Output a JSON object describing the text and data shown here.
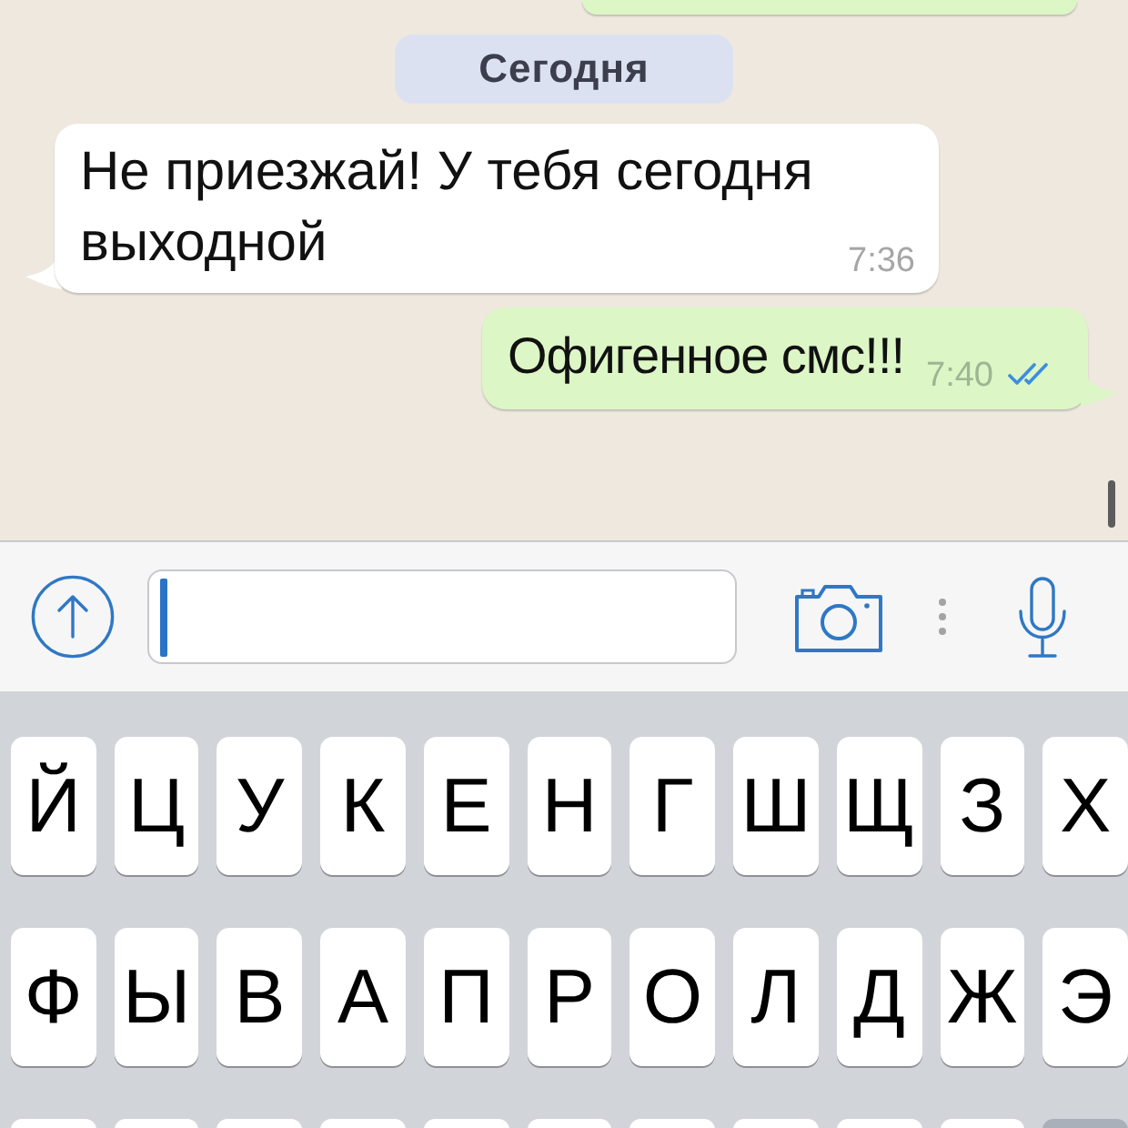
{
  "chat": {
    "items": [
      {
        "kind": "outgoing",
        "cut_off": true
      },
      {
        "kind": "date",
        "text": "Сегодня"
      },
      {
        "kind": "incoming",
        "cut_off": false,
        "text": "Не приезжай! У тебя сегодня выходной",
        "time": "7:36"
      },
      {
        "kind": "outgoing",
        "cut_off": false,
        "text": "Офигенное смс!!!",
        "time": "7:40",
        "read": true
      }
    ]
  },
  "composer": {
    "focused": true
  },
  "keyboard": {
    "rows": [
      {
        "cut_off": false,
        "keys": [
          {
            "kind": "letter",
            "label": "Й"
          },
          {
            "kind": "letter",
            "label": "Ц"
          },
          {
            "kind": "letter",
            "label": "У"
          },
          {
            "kind": "letter",
            "label": "К"
          },
          {
            "kind": "letter",
            "label": "Е"
          },
          {
            "kind": "letter",
            "label": "Н"
          },
          {
            "kind": "letter",
            "label": "Г"
          },
          {
            "kind": "letter",
            "label": "Ш"
          },
          {
            "kind": "letter",
            "label": "Щ"
          },
          {
            "kind": "letter",
            "label": "З"
          },
          {
            "kind": "letter",
            "label": "Х"
          }
        ]
      },
      {
        "cut_off": false,
        "keys": [
          {
            "kind": "letter",
            "label": "Ф"
          },
          {
            "kind": "letter",
            "label": "Ы"
          },
          {
            "kind": "letter",
            "label": "В"
          },
          {
            "kind": "letter",
            "label": "А"
          },
          {
            "kind": "letter",
            "label": "П"
          },
          {
            "kind": "letter",
            "label": "Р"
          },
          {
            "kind": "letter",
            "label": "О"
          },
          {
            "kind": "letter",
            "label": "Л"
          },
          {
            "kind": "letter",
            "label": "Д"
          },
          {
            "kind": "letter",
            "label": "Ж"
          },
          {
            "kind": "letter",
            "label": "Э"
          }
        ]
      },
      {
        "cut_off": true,
        "keys": [
          {
            "kind": "letter"
          },
          {
            "kind": "letter"
          },
          {
            "kind": "letter"
          },
          {
            "kind": "letter"
          },
          {
            "kind": "letter"
          },
          {
            "kind": "letter"
          },
          {
            "kind": "letter"
          },
          {
            "kind": "letter"
          },
          {
            "kind": "letter"
          },
          {
            "kind": "letter"
          },
          {
            "kind": "function"
          }
        ]
      }
    ]
  }
}
